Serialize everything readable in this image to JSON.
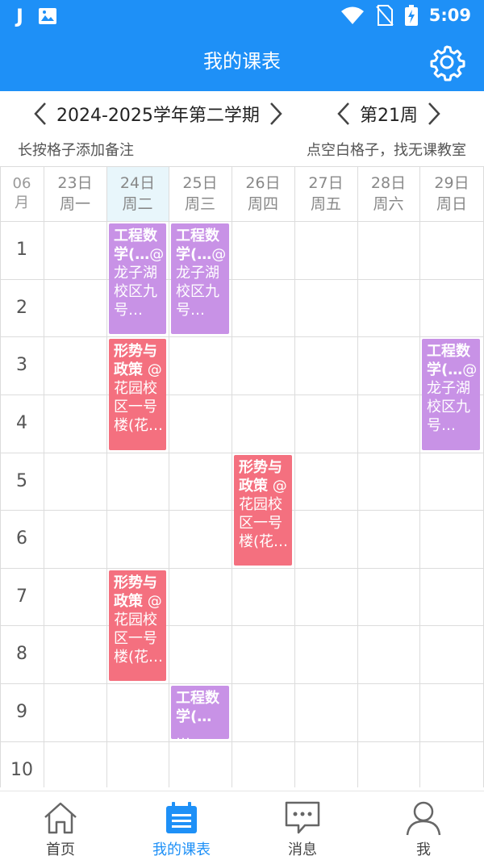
{
  "status_bar": {
    "time": "5:09",
    "app_glyph": "J"
  },
  "app_bar": {
    "title": "我的课表"
  },
  "selector": {
    "semester": "2024-2025学年第二学期",
    "week": "第21周"
  },
  "hints": {
    "left": "长按格子添加备注",
    "right": "点空白格子，找无课教室"
  },
  "grid": {
    "month_number": "06",
    "month_unit": "月",
    "days": [
      {
        "date": "23日",
        "weekday": "周一"
      },
      {
        "date": "24日",
        "weekday": "周二"
      },
      {
        "date": "25日",
        "weekday": "周三"
      },
      {
        "date": "26日",
        "weekday": "周四"
      },
      {
        "date": "27日",
        "weekday": "周五"
      },
      {
        "date": "28日",
        "weekday": "周六"
      },
      {
        "date": "29日",
        "weekday": "周日"
      }
    ],
    "periods": [
      "1",
      "2",
      "3",
      "4",
      "5",
      "6",
      "7",
      "8",
      "9",
      "10"
    ]
  },
  "courses": [
    {
      "name": "工程数学(…",
      "room": "@龙子湖校区九号…"
    },
    {
      "name": "工程数学(…",
      "room": "@龙子湖校区九号…"
    },
    {
      "name": "形势与政策",
      "room": " @花园校区一号楼(花…"
    },
    {
      "name": "工程数学(…",
      "room": "@龙子湖校区九号…"
    },
    {
      "name": "形势与政策",
      "room": " @花园校区一号楼(花…"
    },
    {
      "name": "形势与政策",
      "room": " @花园校区一号楼(花…"
    },
    {
      "name": "工程数学(…",
      "room": " …"
    }
  ],
  "bottom_nav": [
    {
      "label": "首页"
    },
    {
      "label": "我的课表"
    },
    {
      "label": "消息"
    },
    {
      "label": "我"
    }
  ],
  "colors": {
    "primary": "#1e90f7",
    "purple": "#c892e6",
    "red": "#f4707f",
    "today": "#e8f6fb"
  }
}
